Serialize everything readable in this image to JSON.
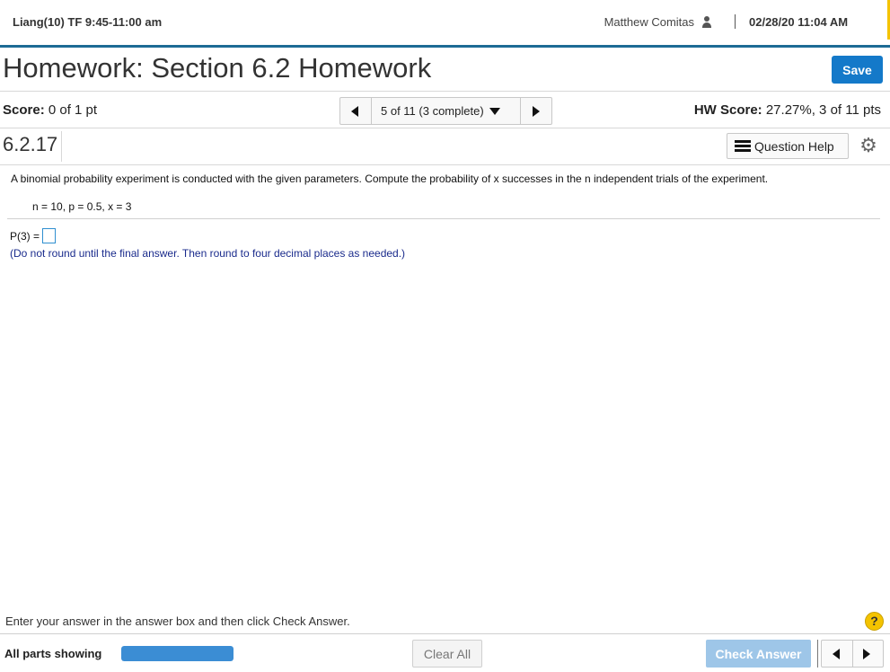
{
  "header": {
    "course": "Liang(10) TF 9:45-11:00 am",
    "user_name": "Matthew Comitas",
    "datetime": "02/28/20 11:04 AM"
  },
  "title": "Homework: Section 6.2 Homework",
  "save_label": "Save",
  "score": {
    "label": "Score:",
    "value": "0 of 1 pt"
  },
  "navigation": {
    "position_label": "5 of 11 (3 complete)"
  },
  "hw_score": {
    "label": "HW Score:",
    "value": "27.27%, 3 of 11 pts"
  },
  "question": {
    "number": "6.2.17",
    "help_label": "Question Help",
    "text": "A binomial probability experiment is conducted with the given parameters. Compute the probability of x successes in the n independent trials of the experiment.",
    "parameters": "n = 10, p = 0.5, x = 3",
    "answer_prefix": "P(3) =",
    "answer_value": "",
    "instructions": "(Do not round until the final answer. Then round to four decimal places as needed.)"
  },
  "footer": {
    "enter_message": "Enter your answer in the answer box and then click Check Answer.",
    "help_glyph": "?",
    "parts_label": "All parts showing",
    "progress_fraction": 1.0,
    "clear_all_label": "Clear All",
    "check_answer_label": "Check Answer"
  },
  "colors": {
    "accent_blue": "#1479c9",
    "header_rule": "#1d6b95",
    "help_yellow": "#f4c300",
    "instruction_text": "#1a2b8c"
  },
  "icons": [
    "user-icon",
    "prev-icon",
    "next-icon",
    "dropdown-icon",
    "list-icon",
    "gear-icon",
    "help-icon"
  ]
}
